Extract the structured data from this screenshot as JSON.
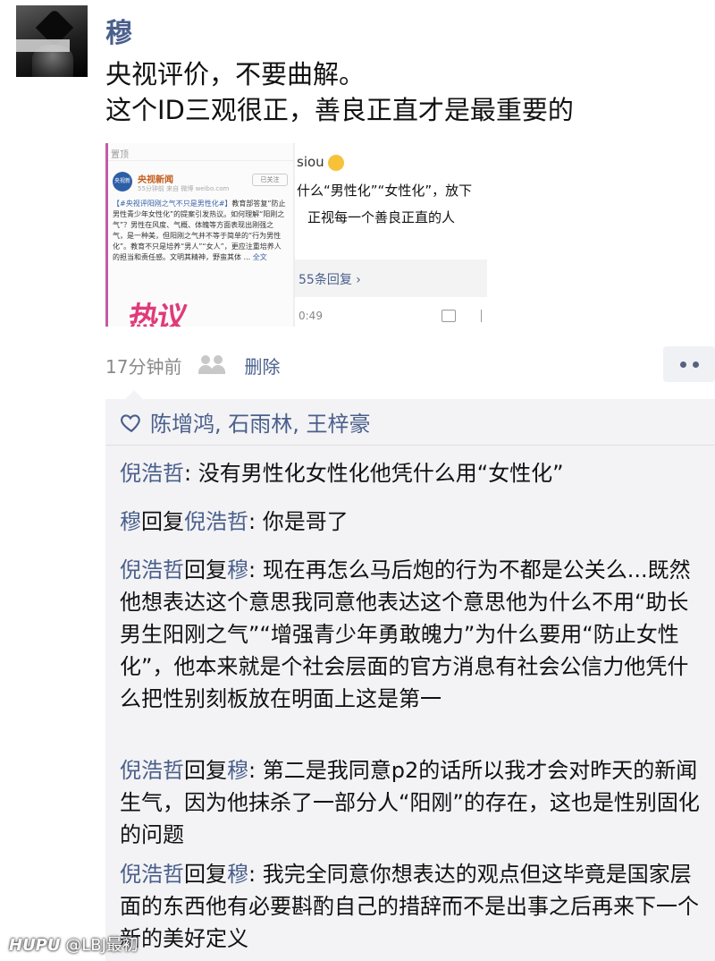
{
  "post": {
    "author": "穆",
    "text_line1": "央视评价，不要曲解。",
    "text_line2": "这个ID三观很正，善良正直才是最重要的",
    "time_ago": "17分钟前",
    "delete_label": "删除"
  },
  "thumbnail_left": {
    "top_label": "置顶",
    "account_name": "央视新闻",
    "logo_text": "央视新闻",
    "meta": "55分钟前  来自 微博 weibo.com",
    "follow_label": "已关注",
    "hashtag": "【#央视评阳刚之气不只是男性化#】",
    "body": "教育部答复“防止男性青少年女性化”的提案引发热议。如何理解“阳刚之气”？男性在风度、气概、体魄等方面表现出刚强之气，是一种美，但阳刚之气并不等于简单的“行为男性化”。教育不只是培养“男人”“女人”，更应注重培养人的担当和责任感。文明其精神，野蛮其体 ...",
    "more_link": "全文",
    "art_text": "热议"
  },
  "thumbnail_right": {
    "user": "siou",
    "line1": "什么“男性化”“女性化”，放下",
    "line2": "正视每一个善良正直的人",
    "replies": "55条回复 ›",
    "time": "0:49"
  },
  "likes": {
    "names": "陈增鸿, 石雨林, 王梓豪"
  },
  "comments": [
    {
      "author": "倪浩哲",
      "reply_word": "",
      "target": "",
      "text": ": 没有男性化女性化他凭什么用“女性化”"
    },
    {
      "author": "穆",
      "reply_word": "回复",
      "target": "倪浩哲",
      "text": ": 你是哥了"
    },
    {
      "author": "倪浩哲",
      "reply_word": "回复",
      "target": "穆",
      "text": ": 现在再怎么马后炮的行为不都是公关么...既然他想表达这个意思我同意他表达这个意思他为什么不用“助长男生阳刚之气”“增强青少年勇敢魄力”为什么要用“防止女性化”，他本来就是个社会层面的官方消息有社会公信力他凭什么把性别刻板放在明面上这是第一"
    },
    {
      "author": "倪浩哲",
      "reply_word": "回复",
      "target": "穆",
      "text": ": 第二是我同意p2的话所以我才会对昨天的新闻生气，因为他抹杀了一部分人“阳刚”的存在，这也是性别固化的问题"
    },
    {
      "author": "倪浩哲",
      "reply_word": "回复",
      "target": "穆",
      "text": ": 我完全同意你想表达的观点但这毕竟是国家层面的东西他有必要斟酌自己的措辞而不是出事之后再来下一个新的美好定义"
    }
  ],
  "watermark": {
    "brand": "HUPU",
    "handle": "@LBJ最初"
  },
  "colors": {
    "name_blue": "#4a5f8c",
    "comment_bg": "#f3f3f5",
    "meta_gray": "#8a8a8a"
  }
}
